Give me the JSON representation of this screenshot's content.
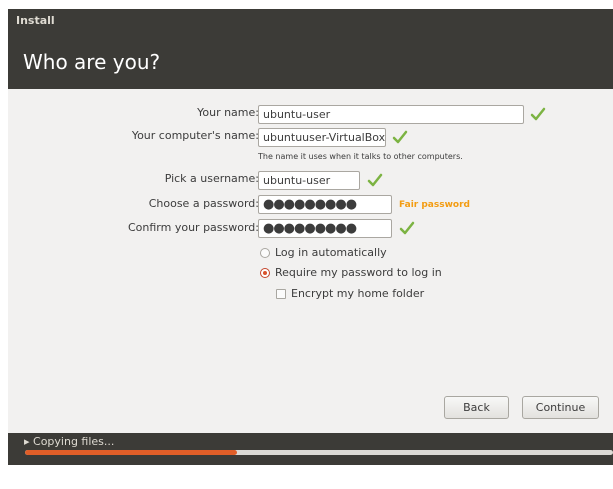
{
  "window": {
    "title": "Install"
  },
  "header": {
    "title": "Who are you?"
  },
  "form": {
    "name_label": "Your name:",
    "name_value": "ubuntu-user",
    "computer_label": "Your computer's name:",
    "computer_value": "ubuntuuser-VirtualBox",
    "computer_hint": "The name it uses when it talks to other computers.",
    "username_label": "Pick a username:",
    "username_value": "ubuntu-user",
    "password_label": "Choose a password:",
    "password_value": "●●●●●●●●●",
    "password_strength": "Fair password",
    "confirm_label": "Confirm your password:",
    "confirm_value": "●●●●●●●●●",
    "login_auto": "Log in automatically",
    "login_require": "Require my password to log in",
    "encrypt_home": "Encrypt my home folder",
    "login_mode": "require",
    "encrypt_checked": false
  },
  "buttons": {
    "back": "Back",
    "continue": "Continue"
  },
  "progress": {
    "label": "▸ Copying files...",
    "fraction": 0.36
  },
  "colors": {
    "accent": "#e05e28",
    "header_bg": "#3c3b37",
    "check_green": "#7cb342",
    "fair": "#f39c12"
  }
}
